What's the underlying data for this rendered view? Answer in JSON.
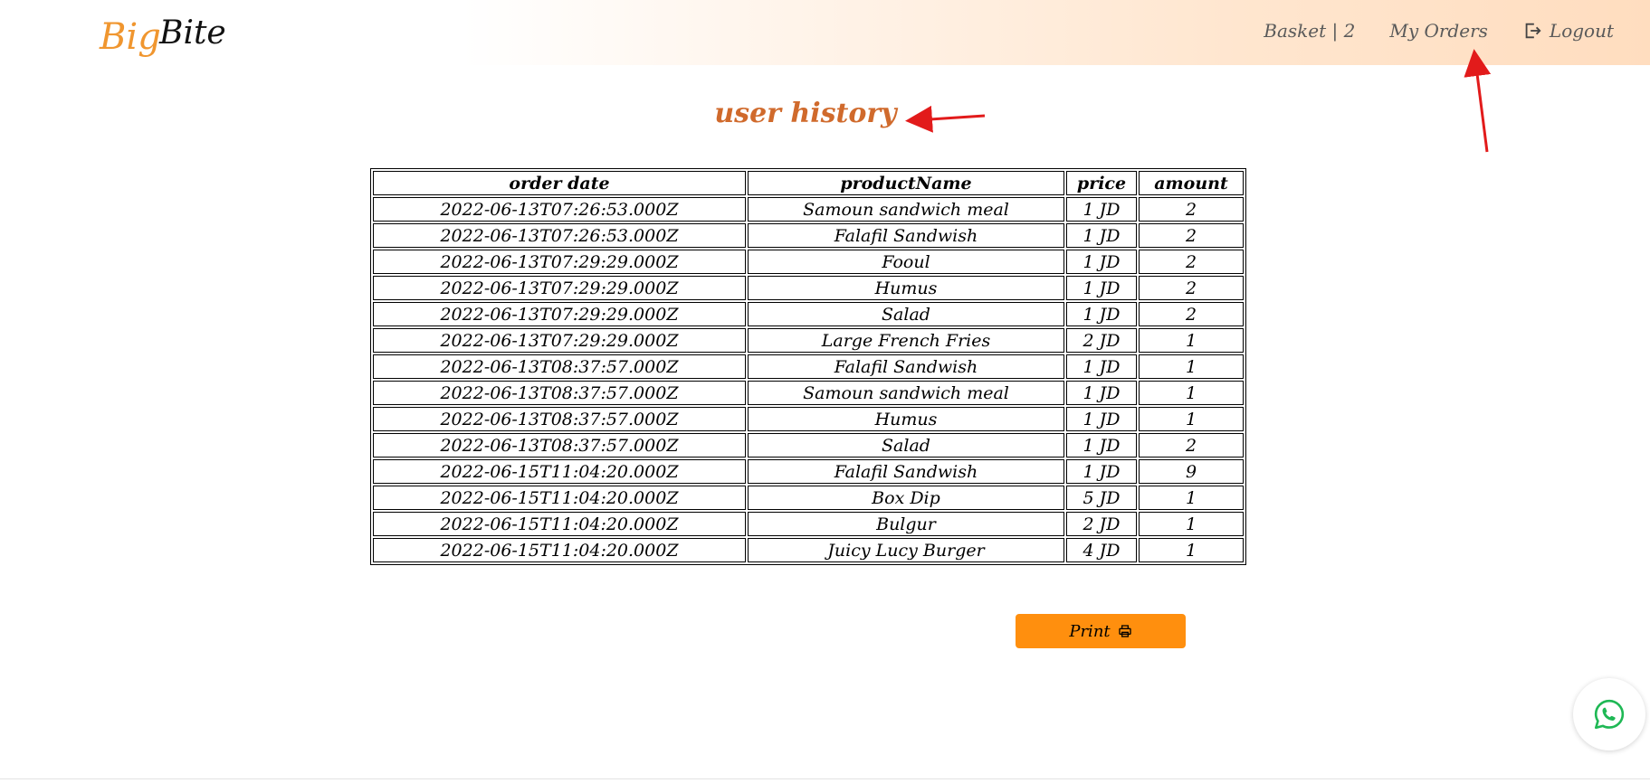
{
  "brand": {
    "logo_text_left": "Big",
    "logo_text_right": "Bite",
    "logo_color_left": "#f0962f",
    "logo_color_right": "#111111"
  },
  "nav": {
    "basket_label": "Basket | 2",
    "orders_label": "My Orders",
    "logout_label": "Logout",
    "logout_icon": "logout-icon"
  },
  "page": {
    "title": "user history",
    "title_color": "#d06a2c"
  },
  "table": {
    "headers": [
      "order date",
      "productName",
      "price",
      "amount"
    ],
    "rows": [
      [
        "2022-06-13T07:26:53.000Z",
        "Samoun sandwich meal",
        "1 JD",
        "2"
      ],
      [
        "2022-06-13T07:26:53.000Z",
        "Falafil Sandwish",
        "1 JD",
        "2"
      ],
      [
        "2022-06-13T07:29:29.000Z",
        "Fooul",
        "1 JD",
        "2"
      ],
      [
        "2022-06-13T07:29:29.000Z",
        "Humus",
        "1 JD",
        "2"
      ],
      [
        "2022-06-13T07:29:29.000Z",
        "Salad",
        "1 JD",
        "2"
      ],
      [
        "2022-06-13T07:29:29.000Z",
        "Large French Fries",
        "2 JD",
        "1"
      ],
      [
        "2022-06-13T08:37:57.000Z",
        "Falafil Sandwish",
        "1 JD",
        "1"
      ],
      [
        "2022-06-13T08:37:57.000Z",
        "Samoun sandwich meal",
        "1 JD",
        "1"
      ],
      [
        "2022-06-13T08:37:57.000Z",
        "Humus",
        "1 JD",
        "1"
      ],
      [
        "2022-06-13T08:37:57.000Z",
        "Salad",
        "1 JD",
        "2"
      ],
      [
        "2022-06-15T11:04:20.000Z",
        "Falafil Sandwish",
        "1 JD",
        "9"
      ],
      [
        "2022-06-15T11:04:20.000Z",
        "Box Dip",
        "5 JD",
        "1"
      ],
      [
        "2022-06-15T11:04:20.000Z",
        "Bulgur",
        "2 JD",
        "1"
      ],
      [
        "2022-06-15T11:04:20.000Z",
        "Juicy Lucy Burger",
        "4 JD",
        "1"
      ]
    ]
  },
  "actions": {
    "print_label": "Print",
    "print_icon": "printer-icon",
    "print_color": "#ff8f0e",
    "chat_icon": "whatsapp-icon"
  },
  "annotations": {
    "arrow_color": "#e21b1b"
  }
}
